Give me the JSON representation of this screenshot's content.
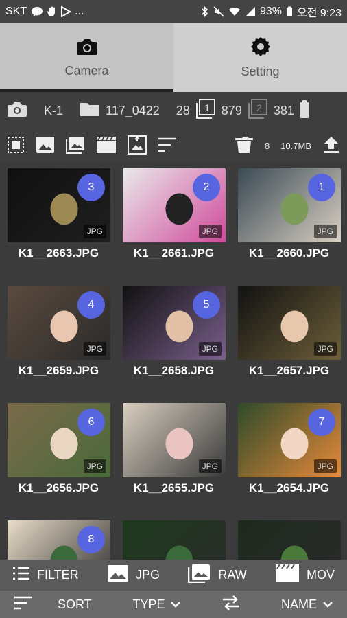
{
  "status": {
    "carrier": "SKT",
    "ellipsis": "...",
    "battery": "93%",
    "time": "오전 9:23"
  },
  "tabs": [
    {
      "label": "Camera"
    },
    {
      "label": "Setting"
    }
  ],
  "info": {
    "camera": "K-1",
    "folder": "117_0422",
    "folder_count": "28",
    "slot1_count": "879",
    "slot2_count": "381"
  },
  "toolbar": {
    "selected_count": "8",
    "size": "10.7MB"
  },
  "photos": [
    {
      "name": "K1__2663.JPG",
      "badge": "3",
      "type": "JPG",
      "colors": [
        "#111",
        "#9e8a55",
        "#1e1e1e"
      ]
    },
    {
      "name": "K1__2661.JPG",
      "badge": "2",
      "type": "JPG",
      "colors": [
        "#e9e9ea",
        "#222",
        "#d04a9b"
      ]
    },
    {
      "name": "K1__2660.JPG",
      "badge": "1",
      "type": "JPG",
      "colors": [
        "#3a4a55",
        "#7c9a5a",
        "#d9cfc2"
      ]
    },
    {
      "name": "K1__2659.JPG",
      "badge": "4",
      "type": "JPG",
      "colors": [
        "#5b4a3e",
        "#e9c6b0",
        "#2a2a2a"
      ]
    },
    {
      "name": "K1__2658.JPG",
      "badge": "5",
      "type": "JPG",
      "colors": [
        "#111",
        "#e2c1a6",
        "#7a5f8c"
      ]
    },
    {
      "name": "K1__2657.JPG",
      "badge": "",
      "type": "JPG",
      "colors": [
        "#111",
        "#e8c8ad",
        "#6e5f3a"
      ]
    },
    {
      "name": "K1__2656.JPG",
      "badge": "6",
      "type": "JPG",
      "colors": [
        "#7a6a4a",
        "#e9d6c3",
        "#4a6a3a"
      ]
    },
    {
      "name": "K1__2655.JPG",
      "badge": "",
      "type": "JPG",
      "colors": [
        "#d9cfc0",
        "#e9c4c0",
        "#3a3a3a"
      ]
    },
    {
      "name": "K1__2654.JPG",
      "badge": "7",
      "type": "JPG",
      "colors": [
        "#2f4a2a",
        "#f1d7c3",
        "#e68a3a"
      ]
    },
    {
      "name": "",
      "badge": "8",
      "type": "",
      "colors": [
        "#e9dcc9",
        "#3a6a3a",
        "#2a2a2a"
      ]
    },
    {
      "name": "",
      "badge": "",
      "type": "",
      "colors": [
        "#1e3a1e",
        "#3a6a3a",
        "#2a2a2a"
      ]
    },
    {
      "name": "",
      "badge": "",
      "type": "",
      "colors": [
        "#1e2a1e",
        "#4a7a3a",
        "#2a2a2a"
      ]
    }
  ],
  "filter": {
    "filter_label": "FILTER",
    "jpg_label": "JPG",
    "raw_label": "RAW",
    "mov_label": "MOV"
  },
  "sortbar": {
    "sort_label": "SORT",
    "type_label": "TYPE",
    "name_label": "NAME"
  }
}
